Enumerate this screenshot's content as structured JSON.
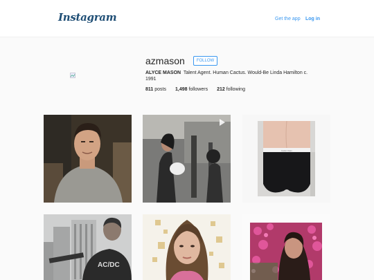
{
  "header": {
    "logo_text": "Instagram",
    "get_app": "Get the app",
    "login": "Log in"
  },
  "profile": {
    "username": "azmason",
    "follow_label": "FOLLOW",
    "full_name": "ALYCE MASON",
    "bio": "Talent Agent. Human Cactus. Would-Be Linda Hamilton c. 1991",
    "posts_count": "811",
    "posts_label": "posts",
    "followers_count": "1,498",
    "followers_label": "followers",
    "following_count": "212",
    "following_label": "following"
  },
  "posts": {
    "watermark_3": "Calvin Klein",
    "shirt_text_4": "AC/DC"
  },
  "colors": {
    "link": "#3897f0",
    "logo": "#1f4e75",
    "background": "#fafafa"
  },
  "icons": {
    "logo": "instagram-wordmark",
    "video": "video-play-icon"
  }
}
